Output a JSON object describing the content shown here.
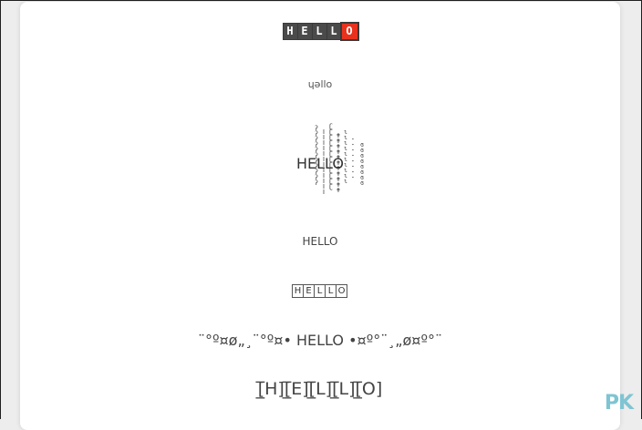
{
  "row1": {
    "letters": [
      "H",
      "E",
      "L",
      "L",
      "O"
    ],
    "accent_color": "#e8321e",
    "box_color": "#4a4a4a"
  },
  "row2": {
    "text": "ɥǝllo"
  },
  "row3": {
    "text": "HELLO"
  },
  "row4": {
    "text": "HELLO"
  },
  "row5": {
    "letters": [
      "H",
      "E",
      "L",
      "L",
      "O"
    ]
  },
  "row6": {
    "text": "¨°º¤ø„¸¨°º¤• HELLO •¤º°¨¸„ø¤º°¨"
  },
  "row7": {
    "text": "[̲̅H][̲̅E][̲̅L][̲̅L][̲̅O]"
  },
  "watermark": {
    "text": "PK",
    "sub": ""
  }
}
